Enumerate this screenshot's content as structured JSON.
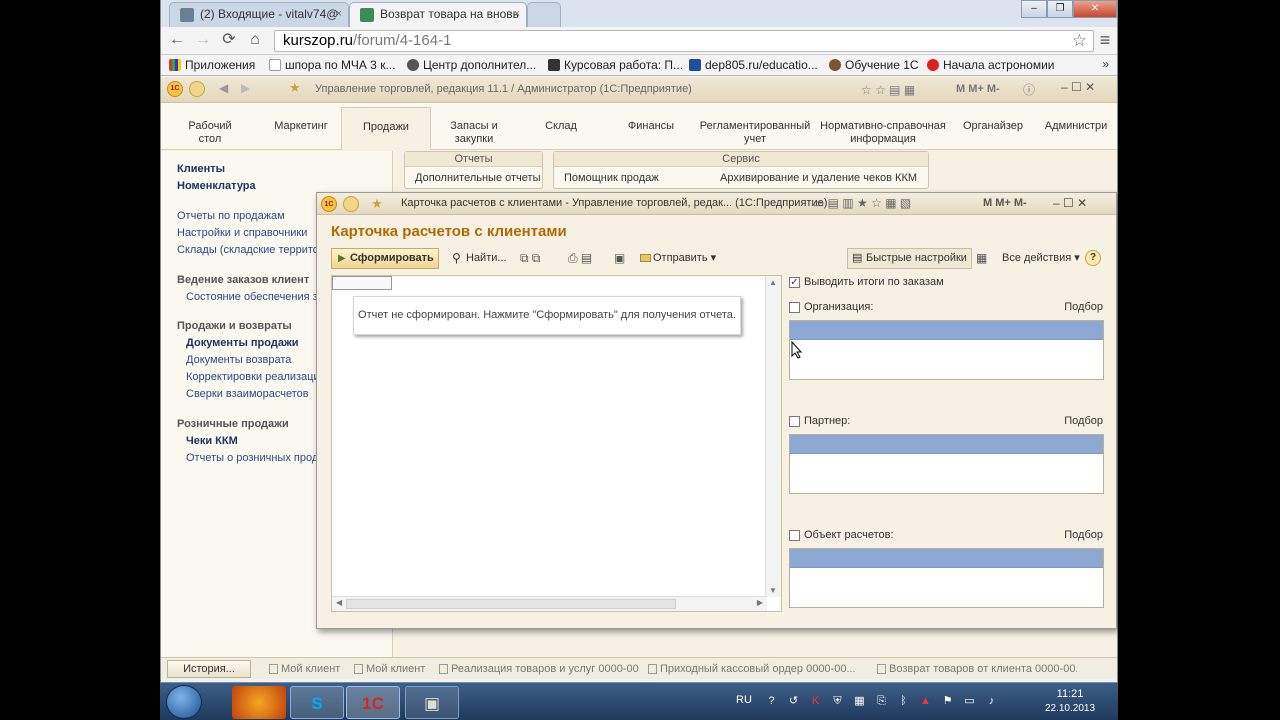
{
  "browser": {
    "tabs": [
      {
        "title": "(2) Входящие - vitalv74@"
      },
      {
        "title": "Возврат товара на вновь"
      }
    ],
    "tab_close": "×",
    "win_buttons": {
      "min": "–",
      "max": "❐",
      "close": "✕"
    },
    "address": {
      "host": "kurszop.ru",
      "path": "/forum/4-164-1"
    },
    "nav": {
      "back": "←",
      "forward": "→",
      "reload": "⟳",
      "home": "⌂",
      "star": "☆",
      "menu": "≡"
    },
    "bookmarks": [
      "Приложения",
      "шпора по МЧА 3 к...",
      "Центр дополнител...",
      "Курсовая работа: П...",
      "dep805.ru/educatio...",
      "Обучение 1С",
      "Начала астрономии"
    ],
    "bookmarks_more": "»"
  },
  "app": {
    "title": "Управление торговлей, редакция 11.1 / Администратор  (1С:Предприятие)",
    "logo": "1С",
    "title_right": "M  M+  M-",
    "sections": [
      {
        "label": "Рабочий\nстол"
      },
      {
        "label": "Маркетинг"
      },
      {
        "label": "Продажи"
      },
      {
        "label": "Запасы и\nзакупки"
      },
      {
        "label": "Склад"
      },
      {
        "label": "Финансы"
      },
      {
        "label": "Регламентированный\nучет"
      },
      {
        "label": "Нормативно-справочная\nинформация"
      },
      {
        "label": "Органайзер"
      },
      {
        "label": "Администри"
      }
    ],
    "nav": [
      "Клиенты",
      "Номенклатура",
      "Отчеты по продажам",
      "Настройки и справочники",
      "Склады (складские территор",
      "Ведение заказов клиент",
      "Состояние обеспечения за",
      "Продажи и возвраты",
      "Документы продажи",
      "Документы возврата",
      "Корректировки реализации",
      "Сверки взаиморасчетов",
      "Розничные продажи",
      "Чеки ККМ",
      "Отчеты о розничных прода"
    ],
    "groups": {
      "reports": {
        "title": "Отчеты",
        "item": "Дополнительные отчеты"
      },
      "service": {
        "title": "Сервис",
        "item1": "Помощник продаж",
        "item2": "Архивирование и удаление чеков ККМ"
      }
    }
  },
  "modal": {
    "title": "Карточка расчетов с клиентами - Управление торговлей, редак...  (1С:Предприятие)",
    "heading": "Карточка расчетов с клиентами",
    "title_right": "M  M+  M-",
    "toolbar": {
      "generate": "Сформировать",
      "find": "Найти...",
      "send": "Отправить",
      "quick_settings": "Быстрые настройки",
      "all_actions": "Все действия",
      "help": "?"
    },
    "report_message": "Отчет не сформирован. Нажмите \"Сформировать\" для получения отчета.",
    "settings": {
      "totals_by_orders": {
        "label": "Выводить итоги по заказам",
        "checked": true
      },
      "organization": {
        "label": "Организация:",
        "pick": "Подбор"
      },
      "partner": {
        "label": "Партнер:",
        "pick": "Подбор"
      },
      "settlement_object": {
        "label": "Объект расчетов:",
        "pick": "Подбор"
      }
    }
  },
  "taskbar_app": {
    "history": "История...",
    "items": [
      "Мой клиент",
      "Мой клиент",
      "Реализация товаров и услуг 0000-00...",
      "Приходный кассовый ордер 0000-00...",
      "Возврат товаров от клиента 0000-00..."
    ]
  },
  "windows": {
    "lang": "RU",
    "time": "11:21",
    "date": "22.10.2013"
  }
}
